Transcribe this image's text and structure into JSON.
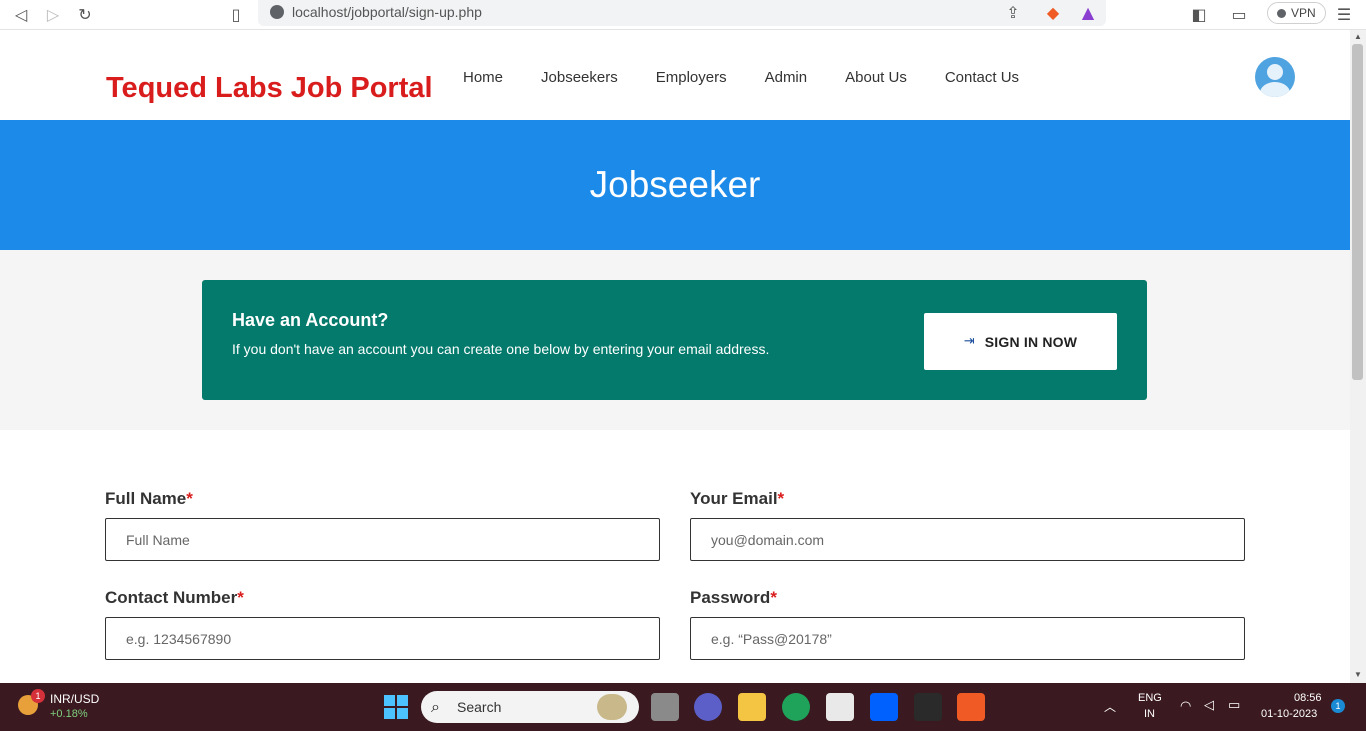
{
  "browser": {
    "url": "localhost/jobportal/sign-up.php",
    "vpn_label": "VPN"
  },
  "header": {
    "logo": "Tequed Labs Job Portal",
    "nav": [
      "Home",
      "Jobseekers",
      "Employers",
      "Admin",
      "About Us",
      "Contact Us"
    ]
  },
  "hero": {
    "title": "Jobseeker"
  },
  "account_box": {
    "title": "Have an Account?",
    "text": "If you don't have an account you can create one below by entering your email address.",
    "button_label": "SIGN IN NOW"
  },
  "form": {
    "full_name": {
      "label": "Full Name",
      "required": "*",
      "placeholder": "Full Name"
    },
    "email": {
      "label": "Your Email",
      "required": "*",
      "placeholder": "you@domain.com"
    },
    "contact": {
      "label": "Contact Number",
      "required": "*",
      "placeholder": "e.g. 1234567890"
    },
    "password": {
      "label": "Password",
      "required": "*",
      "placeholder": "e.g. “Pass@20178”"
    }
  },
  "taskbar": {
    "ticker_name": "INR/USD",
    "ticker_change": "+0.18%",
    "ticker_badge": "1",
    "search_label": "Search",
    "lang_line1": "ENG",
    "lang_line2": "IN",
    "time": "08:56",
    "date": "01-10-2023",
    "notif_count": "1"
  },
  "colors": {
    "brand_red": "#d91c1c",
    "hero_blue": "#1c8ae8",
    "account_teal": "#047a6c"
  }
}
